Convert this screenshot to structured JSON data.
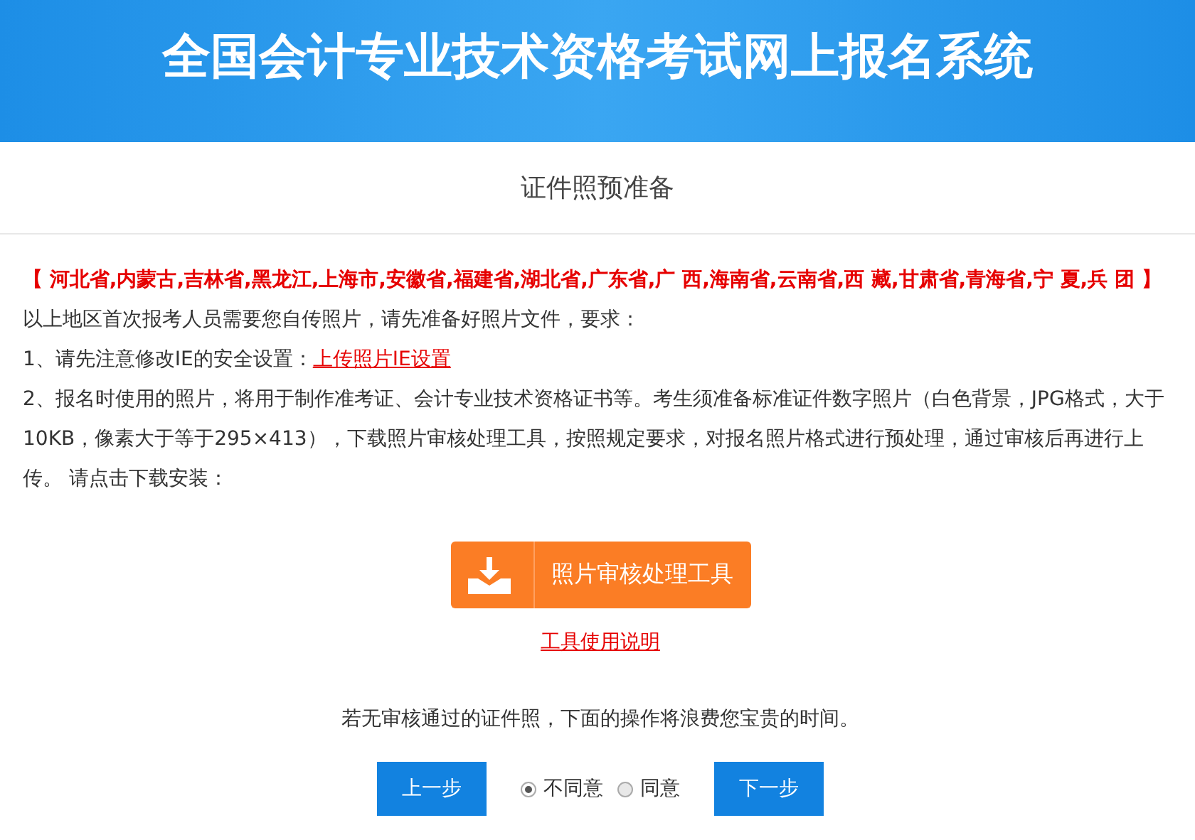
{
  "header": {
    "title": "全国会计专业技术资格考试网上报名系统"
  },
  "page_title": "证件照预准备",
  "notice": "**【 河北省,内蒙古,吉林省,黑龙江,上海市,安徽省,福建省,湖北省,广东省,广 西,海南省,云南省,西 藏,甘肃省,青海省,宁 夏,兵 团 】**以上地区首次报考人员需要您自传照片，请先准备好照片文件，要求：",
  "step1": {
    "text": "1、请先注意修改IE的安全设置：",
    "link": "上传照片IE设置"
  },
  "step2": "2、报名时使用的照片，将用于制作准考证、会计专业技术资格证书等。考生须准备标准证件数字照片（白色背景，JPG格式，大于10KB，像素大于等于295×413），下载照片审核处理工具，按照规定要求，对报名照片格式进行预处理，通过审核后再进行上传。 请点击下载安装：",
  "download_button": "照片审核处理工具",
  "help_link": "工具使用说明",
  "warning": "若无审核通过的证件照，下面的操作将浪费您宝贵的时间。",
  "prev_button": "上一步",
  "options": [
    {
      "label": "不同意",
      "selected": true
    },
    {
      "label": "同意",
      "selected": false
    }
  ],
  "next_button": "下一步"
}
